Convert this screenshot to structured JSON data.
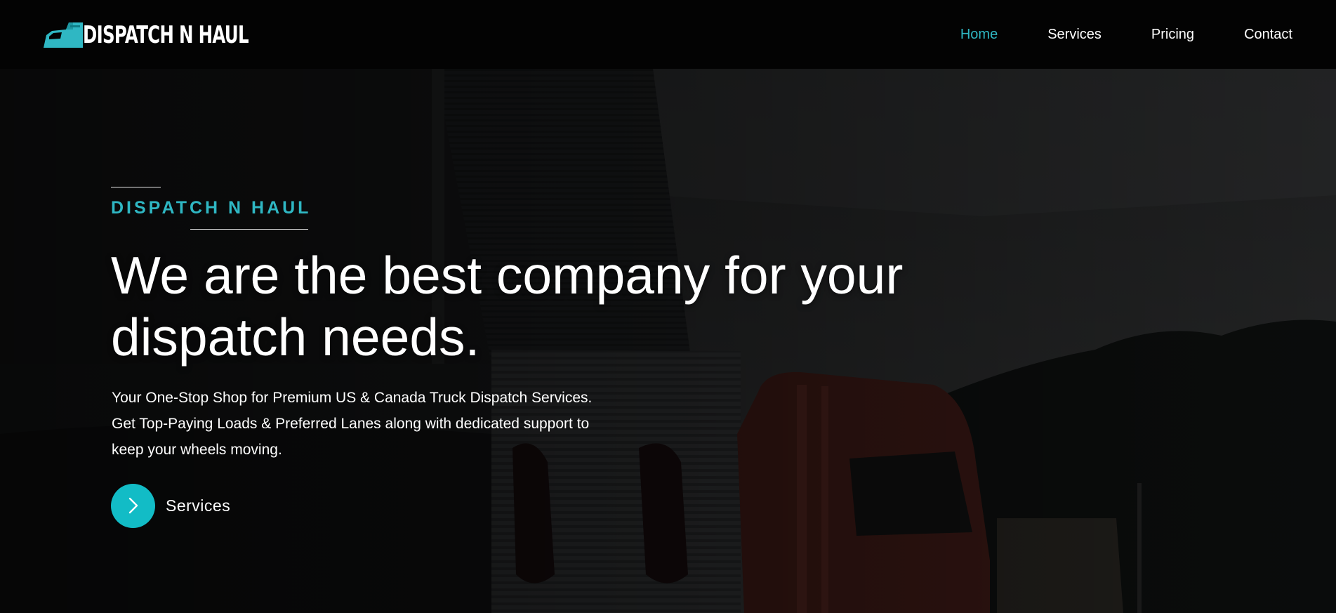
{
  "brand": {
    "name": "DISPATCH N HAUL",
    "accent_color": "#2fb7c3",
    "logo_icon": "truck-icon"
  },
  "nav": {
    "items": [
      {
        "label": "Home",
        "active": true
      },
      {
        "label": "Services",
        "active": false
      },
      {
        "label": "Pricing",
        "active": false
      },
      {
        "label": "Contact",
        "active": false
      }
    ]
  },
  "hero": {
    "eyebrow": "DISPATCH N HAUL",
    "headline_line1": "We are the best company for your",
    "headline_line2": "dispatch needs.",
    "subtext_line1": "Your One-Stop Shop for Premium US & Canada Truck Dispatch Services.",
    "subtext_line2": "Get Top-Paying Loads & Preferred Lanes along with dedicated support to",
    "subtext_line3": "keep your wheels moving.",
    "cta_label": "Services",
    "cta_icon": "chevron-right-icon",
    "background": "truck-warehouse-photo"
  }
}
